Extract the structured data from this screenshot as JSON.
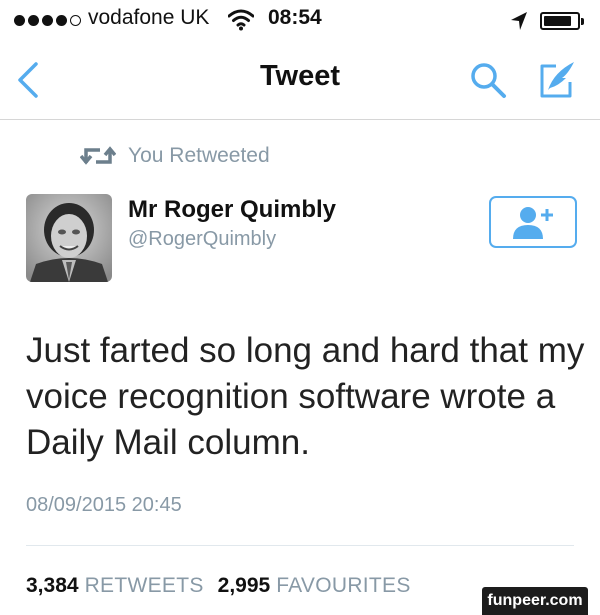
{
  "status_bar": {
    "carrier": "vodafone UK",
    "time": "08:54",
    "signal_bars_filled": 4,
    "signal_bars_total": 5,
    "battery_level": 0.85,
    "icons": [
      "signal-dots-icon",
      "wifi-icon",
      "location-arrow-icon",
      "battery-icon"
    ]
  },
  "nav": {
    "title": "Tweet",
    "back_icon": "chevron-left-icon",
    "search_icon": "search-icon",
    "compose_icon": "compose-icon"
  },
  "tweet": {
    "retweet_label": "You Retweeted",
    "author_name": "Mr Roger Quimbly",
    "author_handle": "@RogerQuimbly",
    "text": "Just farted so long and hard that my voice recognition software wrote a Daily Mail column.",
    "timestamp": "08/09/2015 20:45",
    "retweets_count": "3,384",
    "retweets_label": "RETWEETS",
    "favourites_count": "2,995",
    "favourites_label": "FAVOURITES"
  },
  "watermark": "funpeer.com",
  "colors": {
    "accent": "#55acee",
    "muted": "#8899a6",
    "retweet_icon": "#6c7f8c",
    "text": "#111111"
  }
}
